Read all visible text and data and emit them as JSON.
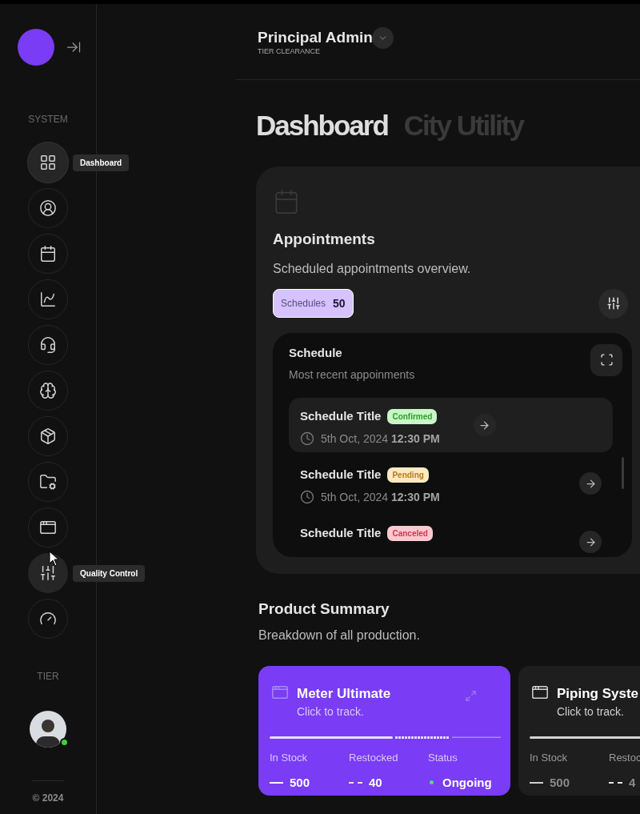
{
  "sidebar": {
    "section_label": "SYSTEM",
    "items": [
      {
        "selected": true,
        "tooltip": "Dashboard"
      },
      {
        "selected": false
      },
      {
        "selected": false
      },
      {
        "selected": false
      },
      {
        "selected": false
      },
      {
        "selected": false
      },
      {
        "selected": false
      },
      {
        "selected": false
      },
      {
        "selected": false
      },
      {
        "selected": false,
        "tooltip": "Quality Control"
      },
      {
        "selected": false
      }
    ],
    "footer_label": "TIER",
    "user": {
      "online": true
    },
    "copyright": "© 2024"
  },
  "header": {
    "name": "Principal Admin",
    "role": "TIER CLEARANCE"
  },
  "tabs": [
    {
      "label": "Dashboard",
      "selected": true
    },
    {
      "label": "City Utility",
      "selected": false
    }
  ],
  "appointments": {
    "title": "Appointments",
    "subtitle": "Scheduled appointments overview.",
    "chip": {
      "label": "Schedules",
      "count": "50"
    },
    "schedule": {
      "title": "Schedule",
      "subtitle": "Most recent appoinments",
      "rows": [
        {
          "title": "Schedule Title",
          "status": "Confirmed",
          "kind": "confirmed",
          "date": "5th Oct, 2024",
          "time": "12:30 PM",
          "selected": true
        },
        {
          "title": "Schedule Title",
          "status": "Pending",
          "kind": "pending",
          "date": "5th Oct, 2024",
          "time": "12:30 PM",
          "selected": false
        },
        {
          "title": "Schedule Title",
          "status": "Canceled",
          "kind": "canceled",
          "selected": false
        }
      ]
    }
  },
  "products": {
    "title": "Product Summary",
    "subtitle": "Breakdown of all production.",
    "cards": [
      {
        "title": "Meter Ultimate",
        "subtitle": "Click to track.",
        "selected": true,
        "stats": [
          {
            "kind": "solid",
            "label": "In Stock",
            "value": "500"
          },
          {
            "kind": "dashed",
            "label": "Restocked",
            "value": "40"
          },
          {
            "kind": "status",
            "label": "Status",
            "value": "Ongoing",
            "color": "#4ade80"
          }
        ]
      },
      {
        "title": "Piping Syste",
        "subtitle": "Click to track.",
        "selected": false,
        "stats": [
          {
            "kind": "solid",
            "label": "In Stock",
            "value": "500"
          },
          {
            "kind": "dashed",
            "label": "Restoc",
            "value": "4"
          }
        ]
      }
    ]
  }
}
